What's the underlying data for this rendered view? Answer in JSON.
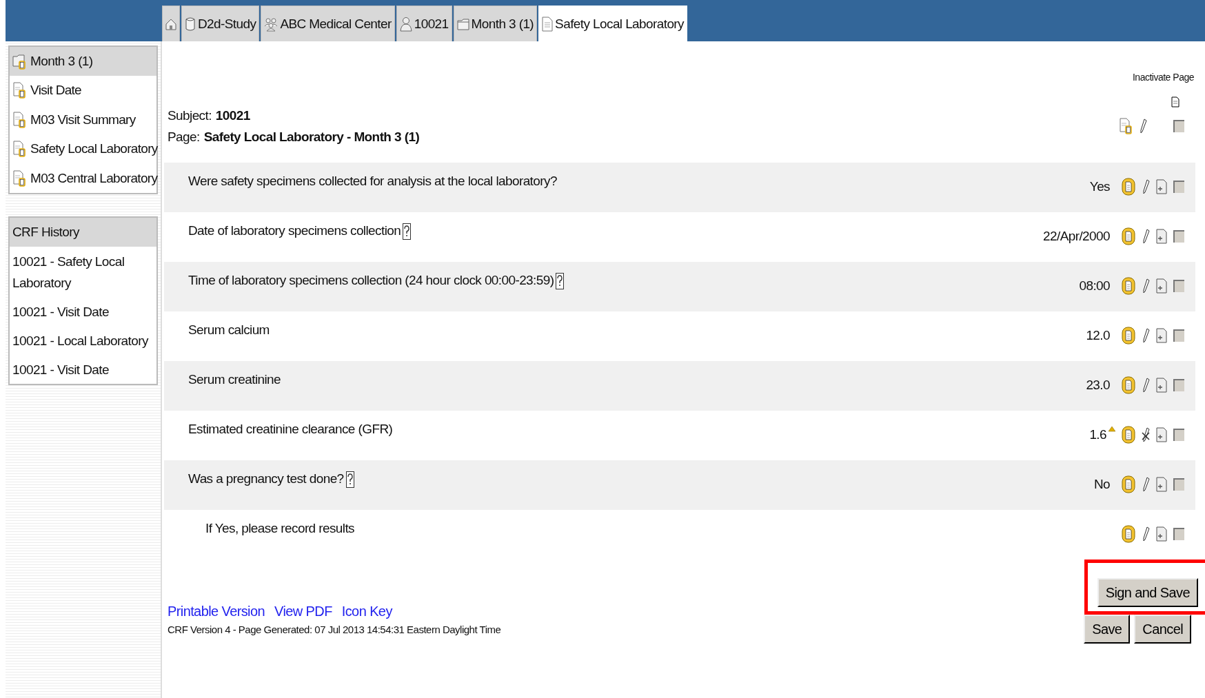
{
  "tabs": [
    {
      "kind": "home",
      "selected": false
    },
    {
      "kind": "study",
      "label": "D2d-Study",
      "selected": false
    },
    {
      "kind": "site",
      "label": "ABC Medical Center",
      "selected": false
    },
    {
      "kind": "subject",
      "label": "10021",
      "selected": false
    },
    {
      "kind": "visit",
      "label": "Month 3 (1)",
      "selected": false
    },
    {
      "kind": "page",
      "label": "Safety Local Laboratory",
      "selected": true
    }
  ],
  "visit_nav": {
    "title": "Month 3 (1)",
    "items": [
      "Visit Date",
      "M03 Visit Summary",
      "Safety Local Laboratory",
      "M03 Central Laboratory"
    ]
  },
  "crf_history": {
    "title": "CRF History",
    "items": [
      "10021 - Safety Local Laboratory",
      "10021 - Visit Date",
      "10021 - Local Laboratory",
      "10021 - Visit Date"
    ]
  },
  "header": {
    "inactivate_label": "Inactivate Page",
    "subject_label": "Subject:",
    "subject": "10021",
    "page_label": "Page:",
    "page": "Safety Local Laboratory - Month 3 (1)",
    "inactivate_checked": false
  },
  "questions": [
    {
      "text": "Were safety specimens collected for analysis at the local laboratory?",
      "help": false,
      "value": "Yes",
      "flagged": false,
      "edit_blocked": false,
      "checked": false
    },
    {
      "text": "Date of laboratory specimens collection",
      "help": true,
      "value": "22/Apr/2000",
      "flagged": false,
      "edit_blocked": false,
      "checked": false
    },
    {
      "text": "Time of laboratory specimens collection (24 hour clock 00:00-23:59)",
      "help": true,
      "value": "08:00",
      "flagged": false,
      "edit_blocked": false,
      "checked": false
    },
    {
      "text": "Serum calcium",
      "help": false,
      "value": "12.0",
      "flagged": false,
      "edit_blocked": false,
      "checked": false
    },
    {
      "text": "Serum creatinine",
      "help": false,
      "value": "23.0",
      "flagged": false,
      "edit_blocked": false,
      "checked": false
    },
    {
      "text": "Estimated creatinine clearance (GFR)",
      "help": false,
      "value": "1.6",
      "flagged": true,
      "edit_blocked": true,
      "checked": false
    },
    {
      "text": "Was a pregnancy test done?",
      "help": true,
      "value": "No",
      "flagged": false,
      "edit_blocked": false,
      "checked": false,
      "children": [
        {
          "text": "If Yes, please record results",
          "help": false,
          "flagged": false,
          "edit_blocked": false,
          "checked": false
        }
      ]
    }
  ],
  "buttons": [
    {
      "label": "Sign and Save",
      "highlighted": true
    },
    {
      "label": "Save",
      "highlighted": false
    },
    {
      "label": "Cancel",
      "highlighted": false
    }
  ],
  "links": [
    "Printable Version",
    "View PDF",
    "Icon Key"
  ],
  "footer": "CRF Version 4 - Page Generated: 07 Jul 2013 14:54:31 Eastern Daylight Time"
}
